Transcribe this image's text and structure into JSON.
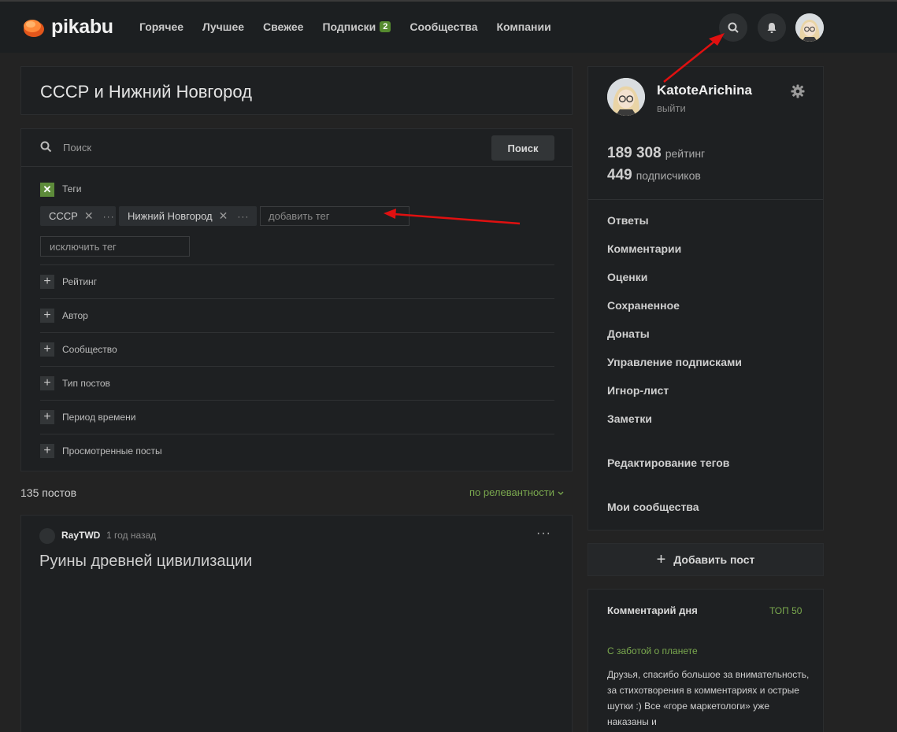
{
  "header": {
    "logo_text": "pikabu",
    "nav": [
      {
        "label": "Горячее"
      },
      {
        "label": "Лучшее"
      },
      {
        "label": "Свежее"
      },
      {
        "label": "Подписки",
        "badge": "2"
      },
      {
        "label": "Сообщества"
      },
      {
        "label": "Компании"
      }
    ],
    "icons": [
      "search-icon",
      "bell-icon",
      "avatar"
    ]
  },
  "page": {
    "title": "СССР и Нижний Новгород"
  },
  "search": {
    "placeholder": "Поиск",
    "button": "Поиск",
    "tags_label": "Теги",
    "tags_checked_mark": "✕",
    "tags": [
      {
        "label": "СССР",
        "remove": "✕",
        "more": "···"
      },
      {
        "label": "Нижний Новгород",
        "remove": "✕",
        "more": "···"
      }
    ],
    "add_tag_placeholder": "добавить тег",
    "exclude_tag_placeholder": "исключить тег",
    "filters": [
      {
        "label": "Рейтинг"
      },
      {
        "label": "Автор"
      },
      {
        "label": "Сообщество"
      },
      {
        "label": "Тип постов"
      },
      {
        "label": "Период времени"
      },
      {
        "label": "Просмотренные посты"
      }
    ],
    "filter_plus": "+"
  },
  "results": {
    "count": "135 постов",
    "sort": "по релевантности"
  },
  "post": {
    "author": "RayTWD",
    "time": "1 год назад",
    "more": "···",
    "title": "Руины древней цивилизации"
  },
  "profile": {
    "username": "KatoteArichina",
    "logout": "выйти",
    "rating_value": "189 308",
    "rating_label": "рейтинг",
    "subscribers_value": "449",
    "subscribers_label": "подписчиков",
    "menu": [
      {
        "label": "Ответы"
      },
      {
        "label": "Комментарии"
      },
      {
        "label": "Оценки"
      },
      {
        "label": "Сохраненное"
      },
      {
        "label": "Донаты"
      },
      {
        "label": "Управление подписками"
      },
      {
        "label": "Игнор-лист"
      },
      {
        "label": "Заметки"
      },
      {
        "label": "Редактирование тегов"
      },
      {
        "label": "Мои сообщества"
      }
    ]
  },
  "add_post": {
    "plus": "+",
    "label": "Добавить пост"
  },
  "comment_of_day": {
    "title": "Комментарий дня",
    "top_link": "ТОП 50",
    "post_title": "С заботой о планете",
    "text": "Друзья, спасибо большое за внимательность, за стихотворения в комментариях и острые шутки :) Все «горе маркетологи» уже наказаны и"
  },
  "colors": {
    "accent_green": "#7aa84e",
    "badge_green": "#558b2f",
    "annotation_red": "#e01010",
    "logo_orange": "#ff7b29"
  }
}
